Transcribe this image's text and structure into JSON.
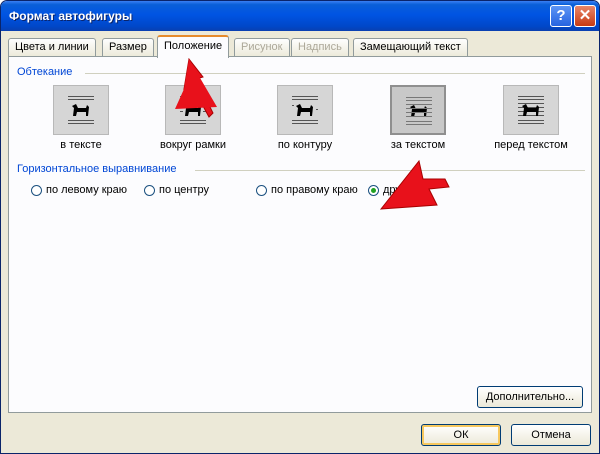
{
  "window": {
    "title": "Формат автофигуры"
  },
  "titlebar_buttons": {
    "help": "?",
    "close": "✕"
  },
  "tabs": [
    {
      "label": "Цвета и линии",
      "state": "normal"
    },
    {
      "label": "Размер",
      "state": "normal"
    },
    {
      "label": "Положение",
      "state": "active"
    },
    {
      "label": "Рисунок",
      "state": "disabled"
    },
    {
      "label": "Надпись",
      "state": "disabled"
    },
    {
      "label": "Замещающий текст",
      "state": "normal"
    }
  ],
  "wrapping": {
    "group_label": "Обтекание",
    "options": [
      {
        "label": "в тексте",
        "icon": "inline-icon",
        "selected": false
      },
      {
        "label": "вокруг рамки",
        "icon": "square-wrap-icon",
        "selected": false
      },
      {
        "label": "по контуру",
        "icon": "tight-wrap-icon",
        "selected": false
      },
      {
        "label": "за текстом",
        "icon": "behind-text-icon",
        "selected": true
      },
      {
        "label": "перед текстом",
        "icon": "in-front-of-text-icon",
        "selected": false
      }
    ]
  },
  "alignment": {
    "group_label": "Горизонтальное выравнивание",
    "options": [
      {
        "label": "по левому краю",
        "checked": false
      },
      {
        "label": "по центру",
        "checked": false
      },
      {
        "label": "по правому краю",
        "checked": false
      },
      {
        "label": "дру",
        "checked": true
      }
    ]
  },
  "buttons": {
    "advanced": "Дополнительно...",
    "ok": "ОК",
    "cancel": "Отмена"
  },
  "colors": {
    "accent_tab": "#e68b2c",
    "group_label": "#0046d5",
    "annotation_arrow": "#e8111b"
  }
}
